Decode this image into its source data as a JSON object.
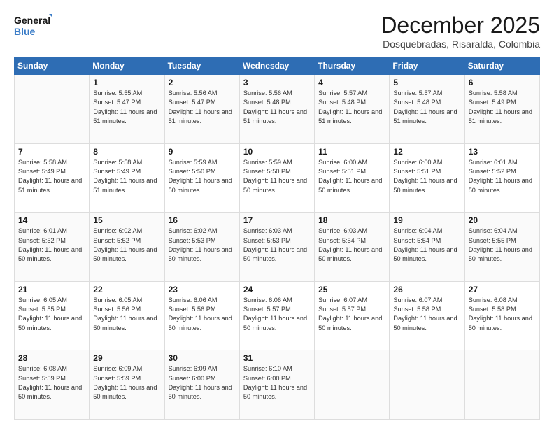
{
  "header": {
    "logo_line1": "General",
    "logo_line2": "Blue",
    "title": "December 2025",
    "subtitle": "Dosquebradas, Risaralda, Colombia"
  },
  "calendar": {
    "days_of_week": [
      "Sunday",
      "Monday",
      "Tuesday",
      "Wednesday",
      "Thursday",
      "Friday",
      "Saturday"
    ],
    "weeks": [
      [
        {
          "day": "",
          "info": ""
        },
        {
          "day": "1",
          "info": "Sunrise: 5:55 AM\nSunset: 5:47 PM\nDaylight: 11 hours\nand 51 minutes."
        },
        {
          "day": "2",
          "info": "Sunrise: 5:56 AM\nSunset: 5:47 PM\nDaylight: 11 hours\nand 51 minutes."
        },
        {
          "day": "3",
          "info": "Sunrise: 5:56 AM\nSunset: 5:48 PM\nDaylight: 11 hours\nand 51 minutes."
        },
        {
          "day": "4",
          "info": "Sunrise: 5:57 AM\nSunset: 5:48 PM\nDaylight: 11 hours\nand 51 minutes."
        },
        {
          "day": "5",
          "info": "Sunrise: 5:57 AM\nSunset: 5:48 PM\nDaylight: 11 hours\nand 51 minutes."
        },
        {
          "day": "6",
          "info": "Sunrise: 5:58 AM\nSunset: 5:49 PM\nDaylight: 11 hours\nand 51 minutes."
        }
      ],
      [
        {
          "day": "7",
          "info": "Sunrise: 5:58 AM\nSunset: 5:49 PM\nDaylight: 11 hours\nand 51 minutes."
        },
        {
          "day": "8",
          "info": "Sunrise: 5:58 AM\nSunset: 5:49 PM\nDaylight: 11 hours\nand 51 minutes."
        },
        {
          "day": "9",
          "info": "Sunrise: 5:59 AM\nSunset: 5:50 PM\nDaylight: 11 hours\nand 50 minutes."
        },
        {
          "day": "10",
          "info": "Sunrise: 5:59 AM\nSunset: 5:50 PM\nDaylight: 11 hours\nand 50 minutes."
        },
        {
          "day": "11",
          "info": "Sunrise: 6:00 AM\nSunset: 5:51 PM\nDaylight: 11 hours\nand 50 minutes."
        },
        {
          "day": "12",
          "info": "Sunrise: 6:00 AM\nSunset: 5:51 PM\nDaylight: 11 hours\nand 50 minutes."
        },
        {
          "day": "13",
          "info": "Sunrise: 6:01 AM\nSunset: 5:52 PM\nDaylight: 11 hours\nand 50 minutes."
        }
      ],
      [
        {
          "day": "14",
          "info": "Sunrise: 6:01 AM\nSunset: 5:52 PM\nDaylight: 11 hours\nand 50 minutes."
        },
        {
          "day": "15",
          "info": "Sunrise: 6:02 AM\nSunset: 5:52 PM\nDaylight: 11 hours\nand 50 minutes."
        },
        {
          "day": "16",
          "info": "Sunrise: 6:02 AM\nSunset: 5:53 PM\nDaylight: 11 hours\nand 50 minutes."
        },
        {
          "day": "17",
          "info": "Sunrise: 6:03 AM\nSunset: 5:53 PM\nDaylight: 11 hours\nand 50 minutes."
        },
        {
          "day": "18",
          "info": "Sunrise: 6:03 AM\nSunset: 5:54 PM\nDaylight: 11 hours\nand 50 minutes."
        },
        {
          "day": "19",
          "info": "Sunrise: 6:04 AM\nSunset: 5:54 PM\nDaylight: 11 hours\nand 50 minutes."
        },
        {
          "day": "20",
          "info": "Sunrise: 6:04 AM\nSunset: 5:55 PM\nDaylight: 11 hours\nand 50 minutes."
        }
      ],
      [
        {
          "day": "21",
          "info": "Sunrise: 6:05 AM\nSunset: 5:55 PM\nDaylight: 11 hours\nand 50 minutes."
        },
        {
          "day": "22",
          "info": "Sunrise: 6:05 AM\nSunset: 5:56 PM\nDaylight: 11 hours\nand 50 minutes."
        },
        {
          "day": "23",
          "info": "Sunrise: 6:06 AM\nSunset: 5:56 PM\nDaylight: 11 hours\nand 50 minutes."
        },
        {
          "day": "24",
          "info": "Sunrise: 6:06 AM\nSunset: 5:57 PM\nDaylight: 11 hours\nand 50 minutes."
        },
        {
          "day": "25",
          "info": "Sunrise: 6:07 AM\nSunset: 5:57 PM\nDaylight: 11 hours\nand 50 minutes."
        },
        {
          "day": "26",
          "info": "Sunrise: 6:07 AM\nSunset: 5:58 PM\nDaylight: 11 hours\nand 50 minutes."
        },
        {
          "day": "27",
          "info": "Sunrise: 6:08 AM\nSunset: 5:58 PM\nDaylight: 11 hours\nand 50 minutes."
        }
      ],
      [
        {
          "day": "28",
          "info": "Sunrise: 6:08 AM\nSunset: 5:59 PM\nDaylight: 11 hours\nand 50 minutes."
        },
        {
          "day": "29",
          "info": "Sunrise: 6:09 AM\nSunset: 5:59 PM\nDaylight: 11 hours\nand 50 minutes."
        },
        {
          "day": "30",
          "info": "Sunrise: 6:09 AM\nSunset: 6:00 PM\nDaylight: 11 hours\nand 50 minutes."
        },
        {
          "day": "31",
          "info": "Sunrise: 6:10 AM\nSunset: 6:00 PM\nDaylight: 11 hours\nand 50 minutes."
        },
        {
          "day": "",
          "info": ""
        },
        {
          "day": "",
          "info": ""
        },
        {
          "day": "",
          "info": ""
        }
      ]
    ]
  }
}
